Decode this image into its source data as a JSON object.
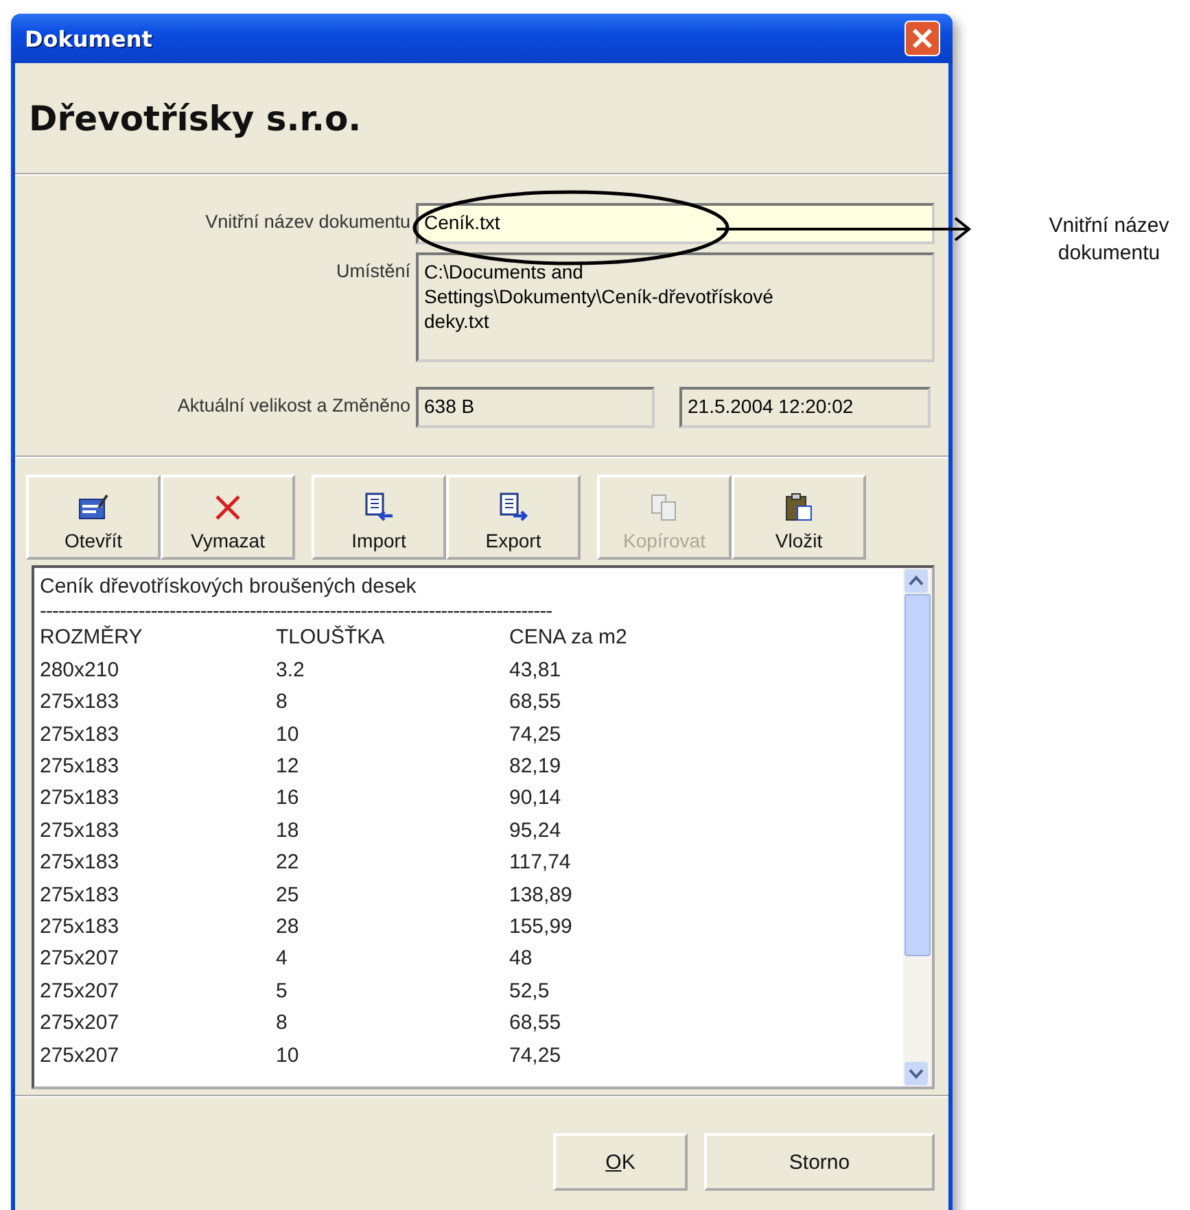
{
  "window": {
    "title": "Dokument"
  },
  "heading": "Dřevotřísky s.r.o.",
  "fields": [
    {
      "label": "Vnitřní název dokumentu",
      "value": "Ceník.txt",
      "kind": "name"
    },
    {
      "label": "Umístění",
      "value": "C:\\Documents and\nSettings\\Dokumenty\\Ceník-dřevotřískové\ndeky.txt",
      "kind": "path"
    }
  ],
  "size_row": {
    "label": "Aktuální velikost a Změněno",
    "size": "638 B",
    "modified": "21.5.2004 12:20:02"
  },
  "toolbar": [
    {
      "label": "Otevřít",
      "disabled": false
    },
    {
      "label": "Vymazat",
      "disabled": false
    },
    {
      "label": "Import",
      "disabled": false
    },
    {
      "label": "Export",
      "disabled": false
    },
    {
      "label": "Kopírovat",
      "disabled": true
    },
    {
      "label": "Vložit",
      "disabled": false
    }
  ],
  "content": {
    "title": "Ceník dřevotřískových broušených desek",
    "separator": "-----------------------------------------------------------------------------------",
    "columns": [
      "ROZMĚRY",
      "TLOUŠŤKA",
      "CENA za m2"
    ],
    "rows": [
      [
        "280x210",
        "3.2",
        "43,81"
      ],
      [
        "275x183",
        "8",
        "68,55"
      ],
      [
        "275x183",
        "10",
        "74,25"
      ],
      [
        "275x183",
        "12",
        "82,19"
      ],
      [
        "275x183",
        "16",
        "90,14"
      ],
      [
        "275x183",
        "18",
        "95,24"
      ],
      [
        "275x183",
        "22",
        "117,74"
      ],
      [
        "275x183",
        "25",
        "138,89"
      ],
      [
        "275x183",
        "28",
        "155,99"
      ],
      [
        "275x207",
        "4",
        "48"
      ],
      [
        "275x207",
        "5",
        "52,5"
      ],
      [
        "275x207",
        "8",
        "68,55"
      ],
      [
        "275x207",
        "10",
        "74,25"
      ]
    ]
  },
  "buttons": [
    "OK",
    "Storno"
  ],
  "annotation": {
    "text": "Vnitřní název dokumentu"
  }
}
